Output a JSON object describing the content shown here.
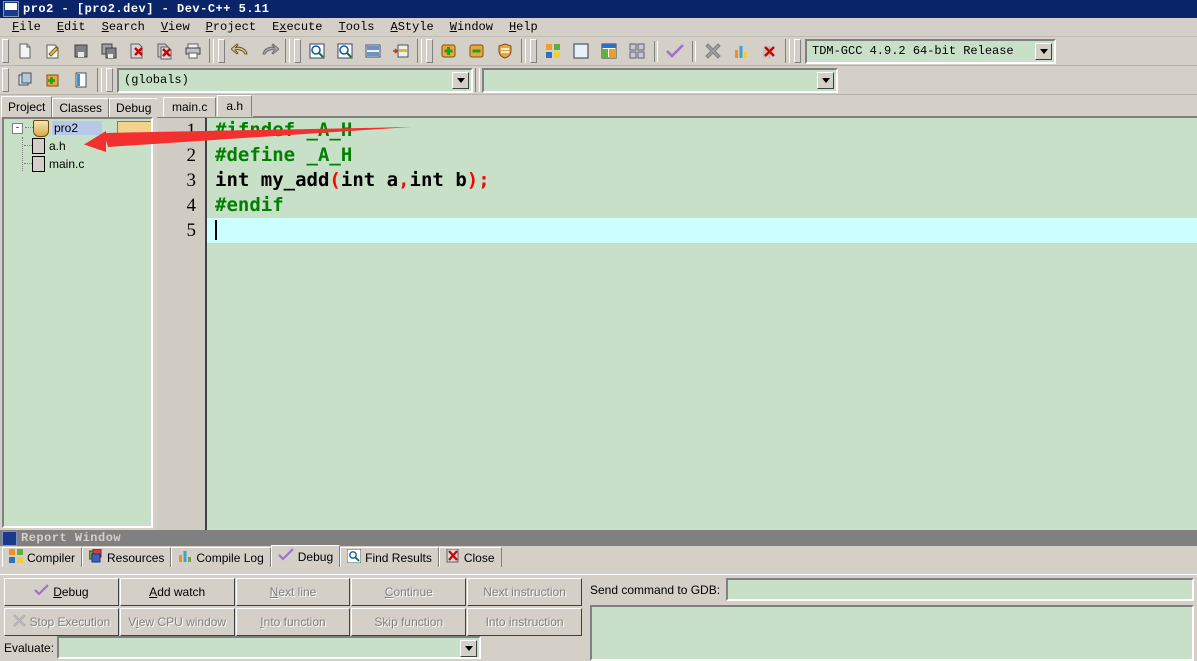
{
  "window": {
    "title": "pro2 - [pro2.dev] - Dev-C++ 5.11",
    "icon": "devcpp-app-icon"
  },
  "menubar": {
    "items": [
      {
        "label": "File",
        "accel": "F"
      },
      {
        "label": "Edit",
        "accel": "E"
      },
      {
        "label": "Search",
        "accel": "S"
      },
      {
        "label": "View",
        "accel": "V"
      },
      {
        "label": "Project",
        "accel": "P"
      },
      {
        "label": "Execute",
        "accel": "x"
      },
      {
        "label": "Tools",
        "accel": "T"
      },
      {
        "label": "AStyle",
        "accel": "A"
      },
      {
        "label": "Window",
        "accel": "W"
      },
      {
        "label": "Help",
        "accel": "H"
      }
    ]
  },
  "toolbar_main": {
    "groups": [
      {
        "icons": [
          "new-file-icon",
          "open-file-icon",
          "save-file-icon",
          "save-all-icon",
          "close-file-icon",
          "close-all-icon",
          "print-icon"
        ]
      },
      {
        "icons": [
          "undo-icon",
          "redo-icon"
        ]
      },
      {
        "icons": [
          "find-icon",
          "replace-icon",
          "goto-line-icon",
          "goto-function-icon"
        ]
      },
      {
        "icons": [
          "zoom-in-icon",
          "zoom-out-icon",
          "shield-icon"
        ]
      },
      {
        "icons": [
          "compile-icon",
          "run-icon",
          "compile-and-run-icon",
          "rebuild-all-icon",
          "syntax-check-icon",
          "stop-execution-icon",
          "profile-icon",
          "delete-profile-icon"
        ]
      }
    ],
    "compiler_combo": {
      "value": "TDM-GCC 4.9.2 64-bit Release",
      "arrow_icon": "chevron-down-icon"
    }
  },
  "toolbar_secondary": {
    "icons": [
      "new-project-icon",
      "add-to-project-icon",
      "project-options-icon"
    ],
    "scope_combo": {
      "value": "(globals)",
      "arrow_icon": "chevron-down-icon"
    },
    "member_combo": {
      "value": "",
      "arrow_icon": "chevron-down-icon"
    }
  },
  "left_panel": {
    "tabs": [
      {
        "label": "Project",
        "active": true
      },
      {
        "label": "Classes",
        "active": false
      },
      {
        "label": "Debug",
        "active": false
      }
    ],
    "tree": {
      "root": {
        "label": "pro2",
        "icon": "project-icon",
        "expander": "-",
        "selected": true
      },
      "children": [
        {
          "label": "a.h",
          "icon": "file-icon"
        },
        {
          "label": "main.c",
          "icon": "file-icon"
        }
      ]
    }
  },
  "editor": {
    "tabs": [
      {
        "label": "main.c",
        "active": false
      },
      {
        "label": "a.h",
        "active": true
      }
    ],
    "lines": [
      {
        "number": "1",
        "current": false,
        "tokens": [
          {
            "t": "#ifndef",
            "c": "pp"
          },
          {
            "t": " ",
            "c": "plain"
          },
          {
            "t": "_A_H",
            "c": "pp"
          }
        ]
      },
      {
        "number": "2",
        "current": false,
        "tokens": [
          {
            "t": "#define",
            "c": "pp"
          },
          {
            "t": " ",
            "c": "plain"
          },
          {
            "t": "_A_H",
            "c": "pp"
          }
        ]
      },
      {
        "number": "3",
        "current": false,
        "tokens": [
          {
            "t": "int",
            "c": "ident"
          },
          {
            "t": " ",
            "c": "plain"
          },
          {
            "t": "my_add",
            "c": "ident"
          },
          {
            "t": "(",
            "c": "punc"
          },
          {
            "t": "int",
            "c": "ident"
          },
          {
            "t": " a",
            "c": "ident"
          },
          {
            "t": ",",
            "c": "punc"
          },
          {
            "t": "int",
            "c": "ident"
          },
          {
            "t": " b",
            "c": "ident"
          },
          {
            "t": ")",
            "c": "punc"
          },
          {
            "t": ";",
            "c": "punc"
          }
        ]
      },
      {
        "number": "4",
        "current": false,
        "tokens": [
          {
            "t": "#endif",
            "c": "pp"
          }
        ]
      },
      {
        "number": "5",
        "current": true,
        "tokens": []
      }
    ]
  },
  "annotation": {
    "arrow_color": "#f23030",
    "points_to": "a.h"
  },
  "report_window": {
    "title": "Report Window",
    "icon": "devcpp-app-icon",
    "tabs": [
      {
        "label": "Compiler",
        "icon": "compiler-icon",
        "active": false
      },
      {
        "label": "Resources",
        "icon": "resources-icon",
        "active": false
      },
      {
        "label": "Compile Log",
        "icon": "compile-log-icon",
        "active": false
      },
      {
        "label": "Debug",
        "icon": "debug-check-icon",
        "active": true
      },
      {
        "label": "Find Results",
        "icon": "find-results-icon",
        "active": false
      },
      {
        "label": "Close",
        "icon": "close-icon",
        "active": false
      }
    ],
    "debug_buttons_row1": [
      {
        "label": "Debug",
        "accel": "D",
        "icon": "debug-check-icon",
        "disabled": false
      },
      {
        "label": "Add watch",
        "accel": "A",
        "disabled": false
      },
      {
        "label": "Next line",
        "accel": "N",
        "disabled": true
      },
      {
        "label": "Continue",
        "accel": "C",
        "disabled": true
      },
      {
        "label": "Next instruction",
        "accel": "",
        "disabled": true
      }
    ],
    "debug_buttons_row2": [
      {
        "label": "Stop Execution",
        "accel": "",
        "icon": "stop-execution-icon",
        "disabled": true
      },
      {
        "label": "View CPU window",
        "accel": "i",
        "disabled": true
      },
      {
        "label": "Into function",
        "accel": "I",
        "disabled": true
      },
      {
        "label": "Skip function",
        "accel": "",
        "disabled": true
      },
      {
        "label": "Into instruction",
        "accel": "",
        "disabled": true
      }
    ],
    "evaluate": {
      "label": "Evaluate:",
      "value": "",
      "arrow_icon": "chevron-down-icon"
    },
    "gdb": {
      "label": "Send command to GDB:",
      "value": "",
      "output": ""
    }
  },
  "colors": {
    "window_bg": "#d4d0c8",
    "title_bg": "#0a246a",
    "editor_bg": "#c8e0c8",
    "current_line": "#ccffff",
    "gutter_bg": "#d0cbc3",
    "keyword": "#008000",
    "punctuation": "#ff0000",
    "selection": "#b8c8e8",
    "arrow": "#f23030"
  }
}
